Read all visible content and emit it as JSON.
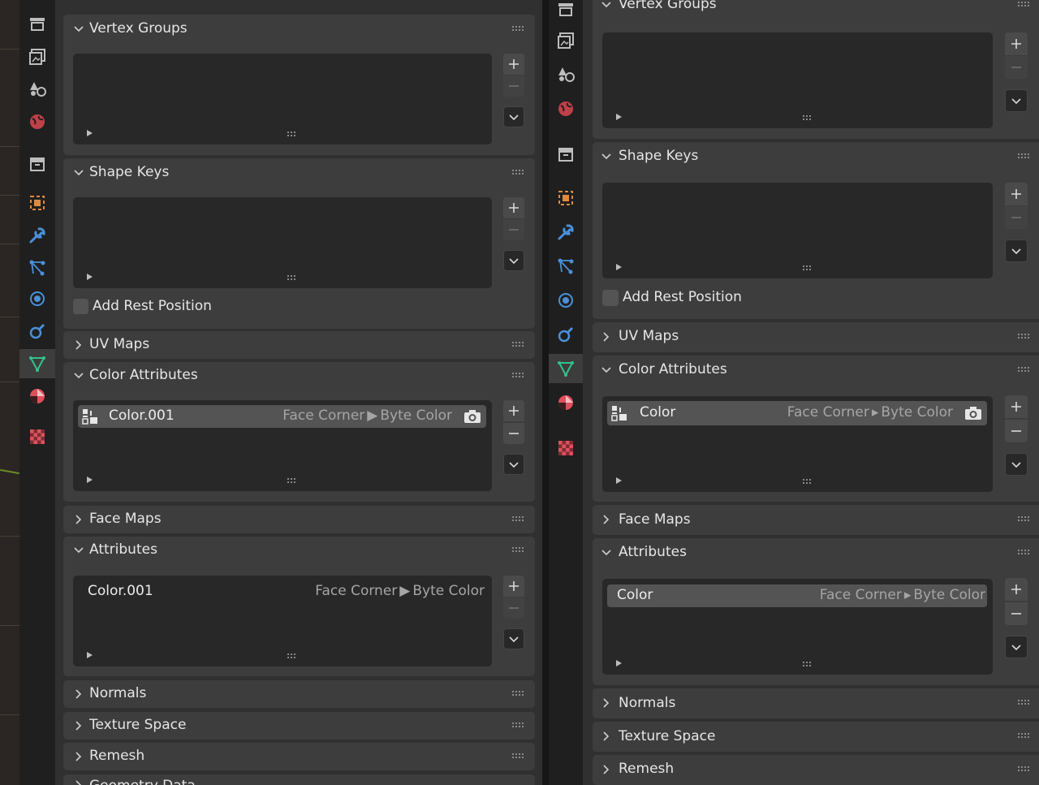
{
  "colors": {
    "panel_bg": "#3d3d3d",
    "list_bg": "#282828",
    "active_tab": "#3d3d3d",
    "accent_object": "#e08a3c",
    "accent_blue": "#4a90d9",
    "accent_green": "#32c28c",
    "accent_red": "#e0505a"
  },
  "left": {
    "tabs": [
      {
        "icon": "render-icon"
      },
      {
        "icon": "output-icon"
      },
      {
        "icon": "view-layer-icon"
      },
      {
        "icon": "scene-icon"
      },
      {
        "icon": "world-icon"
      },
      {
        "icon": "collection-icon"
      },
      {
        "icon": "object-icon"
      },
      {
        "icon": "modifier-wrench-icon"
      },
      {
        "icon": "particles-icon"
      },
      {
        "icon": "physics-icon"
      },
      {
        "icon": "constraints-icon"
      },
      {
        "icon": "object-data-mesh-icon",
        "active": true
      },
      {
        "icon": "material-icon"
      },
      {
        "icon": "texture-icon"
      }
    ],
    "panels": {
      "vertex_groups": "Vertex Groups",
      "shape_keys": "Shape Keys",
      "add_rest_position": "Add Rest Position",
      "uv_maps": "UV Maps",
      "color_attributes": "Color Attributes",
      "color_attr_row": {
        "name": "Color.001",
        "domain": "Face Corner",
        "sep": "▶",
        "type": "Byte Color"
      },
      "face_maps": "Face Maps",
      "attributes": "Attributes",
      "attr_row": {
        "name": "Color.001",
        "domain": "Face Corner",
        "sep": "▶",
        "type": "Byte Color"
      },
      "normals": "Normals",
      "texture_space": "Texture Space",
      "remesh": "Remesh",
      "geometry_data": "Geometry Data"
    }
  },
  "right": {
    "panels": {
      "vertex_groups": "Vertex Groups",
      "shape_keys": "Shape Keys",
      "add_rest_position": "Add Rest Position",
      "uv_maps": "UV Maps",
      "color_attributes": "Color Attributes",
      "color_attr_row": {
        "name": "Color",
        "domain": "Face Corner",
        "sep": "▸",
        "type": "Byte Color"
      },
      "face_maps": "Face Maps",
      "attributes": "Attributes",
      "attr_row": {
        "name": "Color",
        "domain": "Face Corner",
        "sep": "▸",
        "type": "Byte Color"
      },
      "normals": "Normals",
      "texture_space": "Texture Space",
      "remesh": "Remesh"
    }
  }
}
